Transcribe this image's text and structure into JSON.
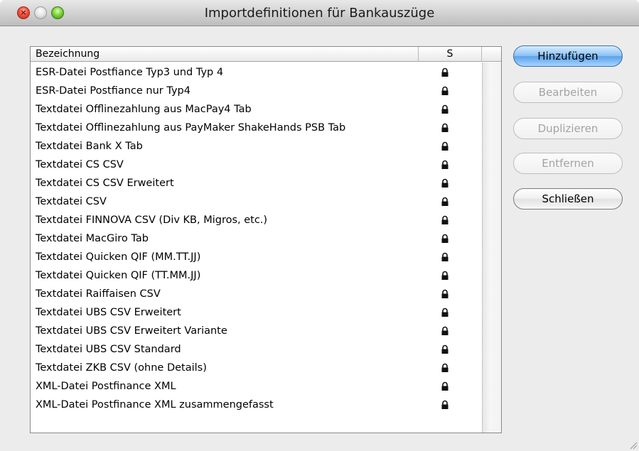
{
  "window": {
    "title": "Importdefinitionen für Bankauszüge"
  },
  "table": {
    "columns": [
      "Bezeichnung",
      "S"
    ],
    "rows": [
      {
        "name": "ESR-Datei Postfiance  Typ3 und Typ 4",
        "icon": "lock-icon"
      },
      {
        "name": "ESR-Datei Postfiance nur Typ4",
        "icon": "lock-icon"
      },
      {
        "name": "Textdatei  Offlinezahlung aus MacPay4 Tab",
        "icon": "lock-icon"
      },
      {
        "name": "Textdatei  Offlinezahlung aus PayMaker ShakeHands PSB Tab",
        "icon": "lock-icon"
      },
      {
        "name": "Textdatei Bank X Tab",
        "icon": "lock-icon"
      },
      {
        "name": "Textdatei CS CSV",
        "icon": "lock-icon"
      },
      {
        "name": "Textdatei CS CSV Erweitert",
        "icon": "lock-icon"
      },
      {
        "name": "Textdatei CSV",
        "icon": "lock-icon"
      },
      {
        "name": "Textdatei FINNOVA CSV (Div KB, Migros, etc.)",
        "icon": "lock-icon"
      },
      {
        "name": "Textdatei MacGiro Tab",
        "icon": "lock-icon"
      },
      {
        "name": "Textdatei Quicken QIF (MM.TT.JJ)",
        "icon": "lock-icon"
      },
      {
        "name": "Textdatei Quicken QIF (TT.MM.JJ)",
        "icon": "lock-icon"
      },
      {
        "name": "Textdatei Raiffaisen CSV",
        "icon": "lock-icon"
      },
      {
        "name": "Textdatei UBS CSV Erweitert",
        "icon": "lock-icon"
      },
      {
        "name": "Textdatei UBS CSV Erweitert Variante",
        "icon": "lock-icon"
      },
      {
        "name": "Textdatei UBS CSV Standard",
        "icon": "lock-icon"
      },
      {
        "name": "Textdatei ZKB CSV (ohne Details)",
        "icon": "lock-icon"
      },
      {
        "name": "XML-Datei Postfinance XML",
        "icon": "lock-icon"
      },
      {
        "name": "XML-Datei Postfinance XML zusammengefasst",
        "icon": "lock-icon"
      }
    ]
  },
  "buttons": {
    "add": "Hinzufügen",
    "edit": "Bearbeiten",
    "duplicate": "Duplizieren",
    "remove": "Entfernen",
    "close": "Schließen"
  },
  "colors": {
    "default_button": "#8cc2f5",
    "close_light": "#f2513c",
    "zoom_light": "#7fd43b"
  }
}
